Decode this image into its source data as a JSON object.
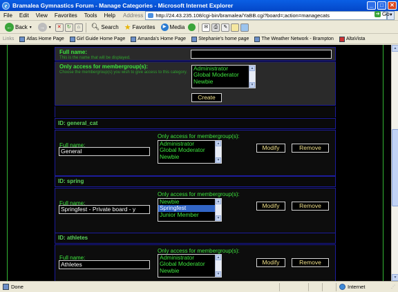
{
  "window": {
    "title": "Bramalea Gymnastics Forum - Manage Categories - Microsoft Internet Explorer"
  },
  "menu": [
    "File",
    "Edit",
    "View",
    "Favorites",
    "Tools",
    "Help"
  ],
  "address": {
    "label": "Address",
    "url": "http://24.43.235.108/cgi-bin/bramalea/YaBB.cgi?board=;action=managecats",
    "go_label": "Go"
  },
  "toolbar": {
    "back": "Back",
    "search": "Search",
    "favorites": "Favorites",
    "media": "Media"
  },
  "links": {
    "label": "Links",
    "items": [
      "Atlas Home Page",
      "Girl Guide Home Page",
      "Amanda's Home Page",
      "Stephanie's home page",
      "The Weather Network - Brampton",
      "AltaVista"
    ]
  },
  "create": {
    "fullname_label": "Full name:",
    "fullname_help": "This is the name that will be displayed.",
    "access_label": "Only access for membergroup(s):",
    "access_help": "Choose the membergroup(s) you wish to give access to this category.",
    "options": [
      "Administrator",
      "Global Moderator",
      "Newbie"
    ],
    "button": "Create"
  },
  "categories": [
    {
      "id_label": "ID: general_cat",
      "fullname_label": "Full name:",
      "value": "General",
      "access_label": "Only access for membergroup(s):",
      "options": [
        "Administrator",
        "Global Moderator",
        "Newbie"
      ],
      "selected": null,
      "modify": "Modify",
      "remove": "Remove"
    },
    {
      "id_label": "ID: spring",
      "fullname_label": "Full name:",
      "value": "Springfest - Private board - y",
      "access_label": "Only access for membergroup(s):",
      "options": [
        "Newbie",
        "Springfest",
        "Junior Member"
      ],
      "selected": "Springfest",
      "modify": "Modify",
      "remove": "Remove"
    },
    {
      "id_label": "ID: athletes",
      "fullname_label": "Full name:",
      "value": "Athletes",
      "access_label": "Only access for membergroup(s):",
      "options": [
        "Administrator",
        "Global Moderator",
        "Newbie"
      ],
      "selected": null,
      "modify": "Modify",
      "remove": "Remove"
    }
  ],
  "status": {
    "left": "Done",
    "zone": "Internet"
  }
}
